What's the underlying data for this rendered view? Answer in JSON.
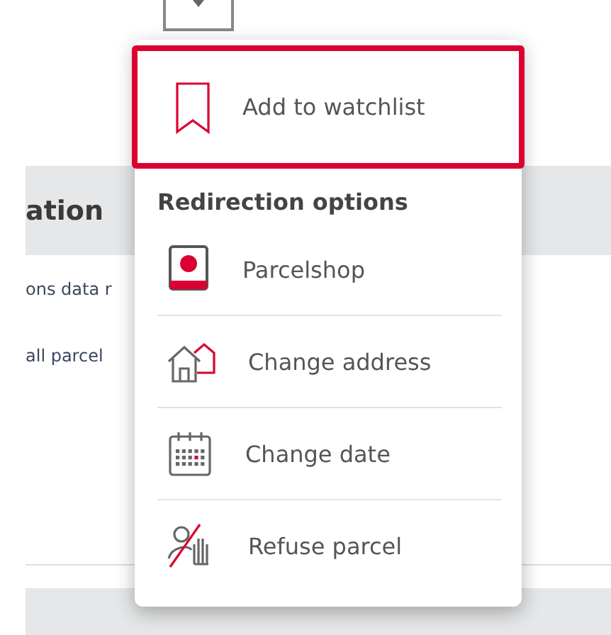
{
  "table": {
    "header": "ation",
    "rows": [
      {
        "cell": "ons data r"
      },
      {
        "cell": "all parcel"
      }
    ]
  },
  "menu": {
    "watchlist": {
      "label": "Add to watchlist",
      "selected": true
    },
    "section_title": "Redirection options",
    "items": [
      {
        "kind": "parcelshop",
        "label": "Parcelshop"
      },
      {
        "kind": "address",
        "label": "Change address"
      },
      {
        "kind": "date",
        "label": "Change date"
      },
      {
        "kind": "refuse",
        "label": "Refuse parcel"
      }
    ]
  }
}
